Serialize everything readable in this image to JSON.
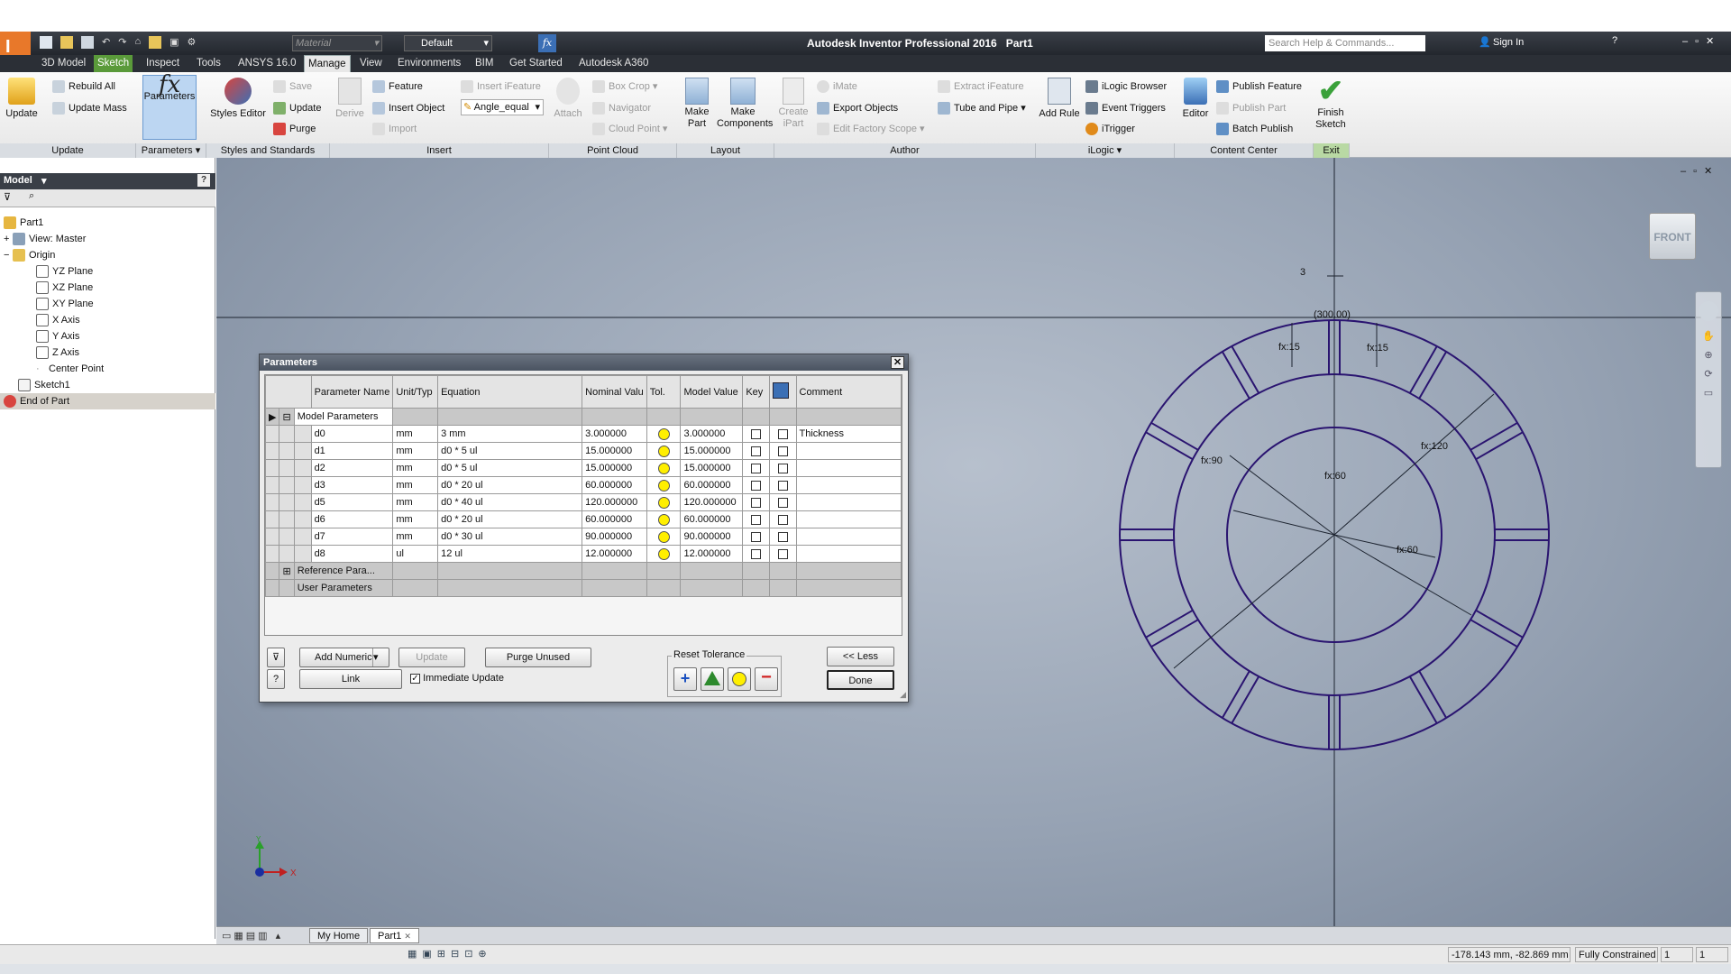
{
  "quick_access": {
    "material_placeholder": "Material",
    "appearance_value": "Default"
  },
  "title": {
    "app": "Autodesk Inventor Professional 2016",
    "document": "Part1",
    "search_placeholder": "Search Help & Commands...",
    "sign_in": "Sign In"
  },
  "ribbon_tabs": [
    "3D Model",
    "Sketch",
    "Inspect",
    "Tools",
    "ANSYS 16.0",
    "Manage",
    "View",
    "Environments",
    "BIM",
    "Get Started",
    "Autodesk A360"
  ],
  "ribbon": {
    "update_group": {
      "label": "Update",
      "update": "Update",
      "rebuild_all": "Rebuild All",
      "update_mass": "Update Mass"
    },
    "parameters_group": {
      "label": "Parameters",
      "parameters": "Parameters"
    },
    "styles_group": {
      "label": "Styles and Standards",
      "styles_editor": "Styles Editor",
      "save": "Save",
      "update": "Update",
      "purge": "Purge"
    },
    "insert_group": {
      "label": "Insert",
      "derive": "Derive",
      "feature": "Feature",
      "insert_object": "Insert Object",
      "import": "Import",
      "insert_ifeature": "Insert iFeature",
      "angle_equal": "Angle_equal"
    },
    "point_cloud_group": {
      "label": "Point Cloud",
      "attach": "Attach",
      "box_crop": "Box Crop",
      "navigator": "Navigator",
      "cloud_point": "Cloud Point"
    },
    "layout_group": {
      "label": "Layout",
      "make_part": "Make Part",
      "make_components": "Make Components"
    },
    "author_group": {
      "label": "Author",
      "create_ipart": "Create iPart",
      "imate": "iMate",
      "export_objects": "Export Objects",
      "edit_factory_scope": "Edit Factory Scope",
      "extract_ifeature": "Extract iFeature",
      "tube_and_pipe": "Tube and Pipe"
    },
    "ilogic_group": {
      "label": "iLogic",
      "add_rule": "Add Rule",
      "ilogic_browser": "iLogic Browser",
      "event_triggers": "Event Triggers",
      "itrigger": "iTrigger"
    },
    "content_center_group": {
      "label": "Content Center",
      "editor": "Editor",
      "publish_feature": "Publish Feature",
      "publish_part": "Publish Part",
      "batch_publish": "Batch Publish"
    },
    "exit_group": {
      "label": "Exit",
      "finish_sketch": "Finish Sketch"
    }
  },
  "browser": {
    "title": "Model",
    "items": [
      {
        "label": "Part1"
      },
      {
        "label": "View: Master"
      },
      {
        "label": "Origin"
      },
      {
        "label": "YZ Plane"
      },
      {
        "label": "XZ Plane"
      },
      {
        "label": "XY Plane"
      },
      {
        "label": "X Axis"
      },
      {
        "label": "Y Axis"
      },
      {
        "label": "Z Axis"
      },
      {
        "label": "Center Point"
      },
      {
        "label": "Sketch1"
      },
      {
        "label": "End of Part"
      }
    ]
  },
  "dialog": {
    "title": "Parameters",
    "columns": [
      "Parameter Name",
      "Unit/Typ",
      "Equation",
      "Nominal Valu",
      "Tol.",
      "Model Value",
      "Key",
      "",
      "Comment"
    ],
    "group_model": "Model Parameters",
    "rows": [
      {
        "name": "d0",
        "unit": "mm",
        "equation": "3 mm",
        "nominal": "3.000000",
        "model": "3.000000",
        "comment": "Thickness"
      },
      {
        "name": "d1",
        "unit": "mm",
        "equation": "d0 * 5 ul",
        "nominal": "15.000000",
        "model": "15.000000",
        "comment": ""
      },
      {
        "name": "d2",
        "unit": "mm",
        "equation": "d0 * 5 ul",
        "nominal": "15.000000",
        "model": "15.000000",
        "comment": ""
      },
      {
        "name": "d3",
        "unit": "mm",
        "equation": "d0 * 20 ul",
        "nominal": "60.000000",
        "model": "60.000000",
        "comment": ""
      },
      {
        "name": "d5",
        "unit": "mm",
        "equation": "d0 * 40 ul",
        "nominal": "120.000000",
        "model": "120.000000",
        "comment": ""
      },
      {
        "name": "d6",
        "unit": "mm",
        "equation": "d0 * 20 ul",
        "nominal": "60.000000",
        "model": "60.000000",
        "comment": ""
      },
      {
        "name": "d7",
        "unit": "mm",
        "equation": "d0 * 30 ul",
        "nominal": "90.000000",
        "model": "90.000000",
        "comment": ""
      },
      {
        "name": "d8",
        "unit": "ul",
        "equation": "12 ul",
        "nominal": "12.000000",
        "model": "12.000000",
        "comment": ""
      }
    ],
    "group_reference": "Reference Para...",
    "group_user": "User Parameters",
    "add_numeric": "Add Numeric",
    "update": "Update",
    "purge_unused": "Purge Unused",
    "link": "Link",
    "immediate_update": "Immediate Update",
    "reset_tolerance": "Reset Tolerance",
    "less": "<< Less",
    "done": "Done"
  },
  "sketch": {
    "dim_top": "3",
    "dim_ref": "(300.00)",
    "dim_fx15_left": "fx:15",
    "dim_fx15_right": "fx:15",
    "dim_fx90": "fx:90",
    "dim_fx120": "fx:120",
    "dim_fx60_top": "fx:60",
    "dim_fx60_bottom": "fx:60",
    "viewcube": "FRONT"
  },
  "doc_tabs": [
    "My Home",
    "Part1"
  ],
  "status": {
    "coords": "-178.143 mm, -82.869 mm",
    "constraint": "Fully Constrained",
    "count1": "1",
    "count2": "1"
  },
  "colors": {
    "sketch_line": "#2a1470",
    "accent": "#3b6fb5",
    "tol_dot": "#ffef00"
  }
}
